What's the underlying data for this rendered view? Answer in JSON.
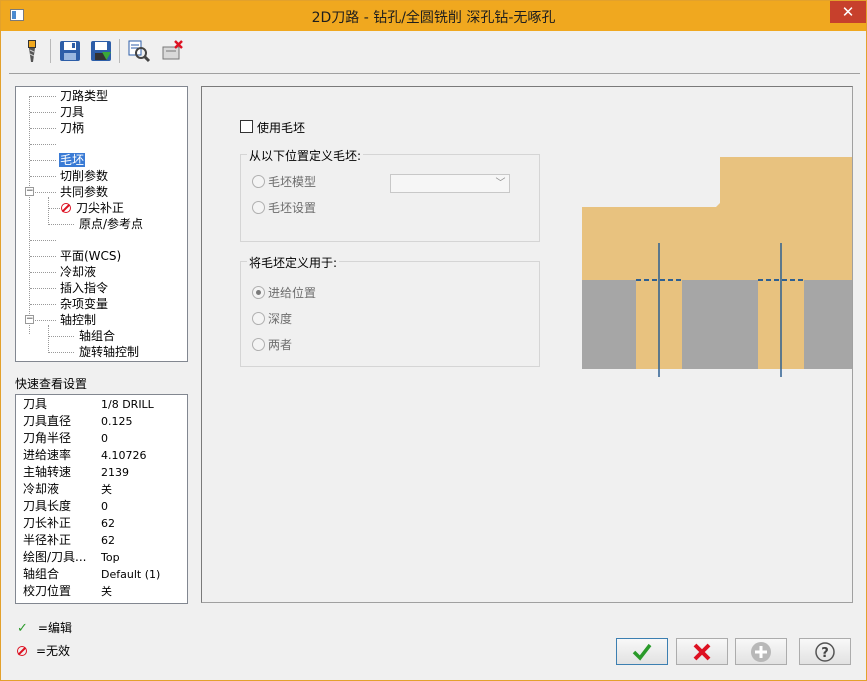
{
  "window": {
    "title": "2D刀路 - 钻孔/全圆铣削 深孔钻-无啄孔",
    "close_label": "✕"
  },
  "toolbar": {
    "icons": [
      "drill-tool-icon",
      "save-icon",
      "save-as-icon",
      "preview-icon",
      "delete-icon"
    ]
  },
  "tree": {
    "items": [
      {
        "label": "刀路类型"
      },
      {
        "label": "刀具"
      },
      {
        "label": "刀柄"
      },
      {
        "label": ""
      },
      {
        "label": "毛坯",
        "selected": true
      },
      {
        "label": "切削参数"
      },
      {
        "label": "共同参数"
      },
      {
        "label": "刀尖补正",
        "invalid": true
      },
      {
        "label": "原点/参考点"
      },
      {
        "label": ""
      },
      {
        "label": "平面(WCS)"
      },
      {
        "label": "冷却液"
      },
      {
        "label": "插入指令"
      },
      {
        "label": "杂项变量"
      },
      {
        "label": "轴控制"
      },
      {
        "label": "轴组合"
      },
      {
        "label": "旋转轴控制"
      }
    ]
  },
  "quickview": {
    "title": "快速查看设置",
    "rows": [
      {
        "k": "刀具",
        "v": "1/8 DRILL"
      },
      {
        "k": "刀具直径",
        "v": "0.125"
      },
      {
        "k": "刀角半径",
        "v": "0"
      },
      {
        "k": "进给速率",
        "v": "4.10726"
      },
      {
        "k": "主轴转速",
        "v": "2139"
      },
      {
        "k": "冷却液",
        "v": "关"
      },
      {
        "k": "刀具长度",
        "v": "0"
      },
      {
        "k": "刀长补正",
        "v": "62"
      },
      {
        "k": "半径补正",
        "v": "62"
      },
      {
        "k": "绘图/刀具...",
        "v": "Top"
      },
      {
        "k": "轴组合",
        "v": "Default (1)"
      },
      {
        "k": "校刀位置",
        "v": "关"
      }
    ]
  },
  "legend": {
    "edit": "=编辑",
    "invalid": "=无效"
  },
  "main": {
    "use_stock_label": "使用毛坯",
    "define_from_title": "从以下位置定义毛坯:",
    "radio_stock_model": "毛坯模型",
    "radio_stock_setup": "毛坯设置",
    "apply_title": "将毛坯定义用于:",
    "radio_feed_position": "进给位置",
    "radio_depth": "深度",
    "radio_both": "两者"
  },
  "colors": {
    "stock": "#e8c27f",
    "part": "#a6a6a6",
    "accent": "#f0a81f",
    "line": "#2e5f91"
  }
}
